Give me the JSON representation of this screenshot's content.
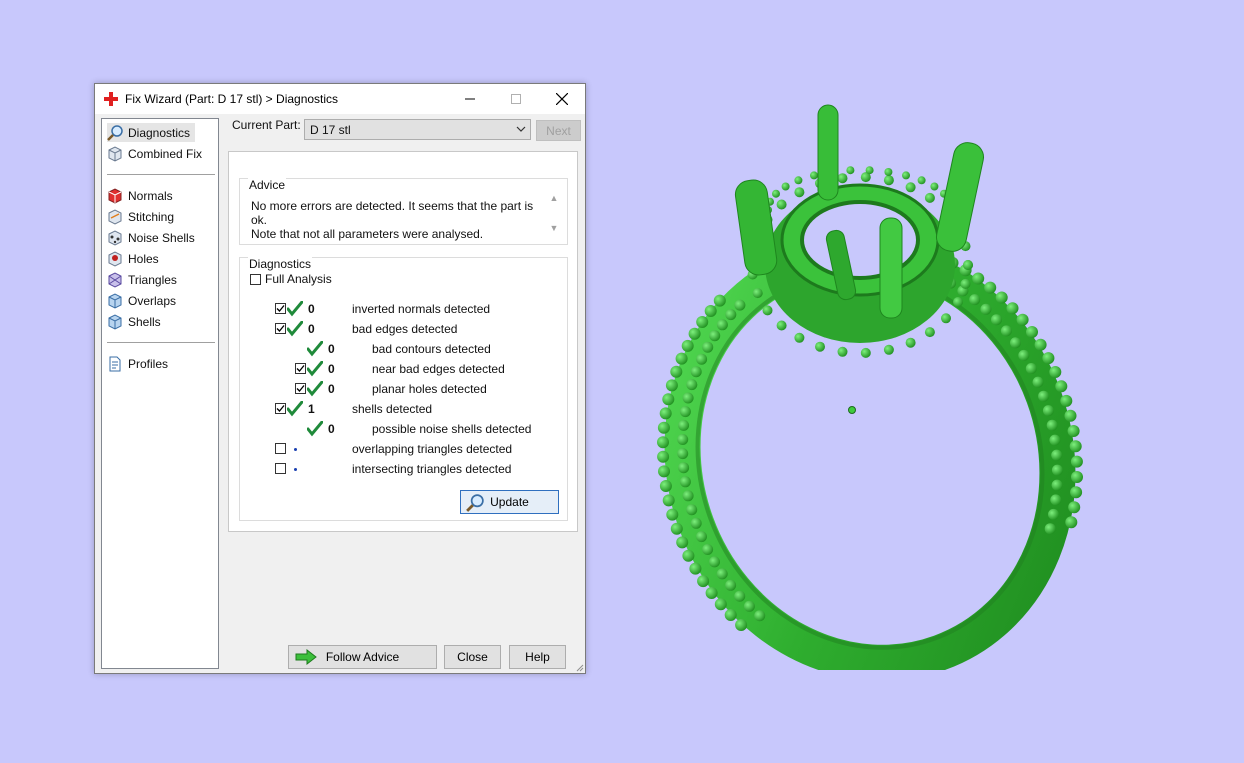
{
  "window": {
    "title": "Fix Wizard (Part: D 17 stl) > Diagnostics"
  },
  "sidebar": {
    "items": [
      {
        "label": "Diagnostics",
        "icon": "magnifier-icon"
      },
      {
        "label": "Combined Fix",
        "icon": "cube-icon"
      },
      {
        "label": "Normals",
        "icon": "normals-icon"
      },
      {
        "label": "Stitching",
        "icon": "stitching-icon"
      },
      {
        "label": "Noise Shells",
        "icon": "noise-shells-icon"
      },
      {
        "label": "Holes",
        "icon": "holes-icon"
      },
      {
        "label": "Triangles",
        "icon": "triangles-icon"
      },
      {
        "label": "Overlaps",
        "icon": "overlaps-icon"
      },
      {
        "label": "Shells",
        "icon": "shells-icon"
      },
      {
        "label": "Profiles",
        "icon": "document-icon"
      }
    ]
  },
  "header": {
    "current_part_label": "Current Part:",
    "current_part_value": "D 17 stl",
    "next_label": "Next"
  },
  "advice": {
    "title": "Advice",
    "line1": "No more errors are detected. It seems that the part is ok.",
    "line2": "Note that not all parameters were analysed."
  },
  "diagnostics": {
    "title": "Diagnostics",
    "full_analysis_label": "Full Analysis",
    "rows": [
      {
        "checked": true,
        "status": "ok",
        "count": "0",
        "label": "inverted normals detected"
      },
      {
        "checked": true,
        "status": "ok",
        "count": "0",
        "label": "bad edges detected"
      },
      {
        "checked": null,
        "status": "ok",
        "count": "0",
        "label": "bad contours detected"
      },
      {
        "checked": true,
        "status": "ok",
        "count": "0",
        "label": "near bad edges detected"
      },
      {
        "checked": true,
        "status": "ok",
        "count": "0",
        "label": "planar holes detected"
      },
      {
        "checked": true,
        "status": "ok",
        "count": "1",
        "label": "shells detected"
      },
      {
        "checked": null,
        "status": "ok",
        "count": "0",
        "label": "possible noise shells detected"
      },
      {
        "checked": false,
        "status": "none",
        "count": "",
        "label": "overlapping triangles detected"
      },
      {
        "checked": false,
        "status": "none",
        "count": "",
        "label": "intersecting triangles detected"
      }
    ],
    "update_label": "Update"
  },
  "footer": {
    "follow_advice_label": "Follow Advice",
    "close_label": "Close",
    "help_label": "Help"
  },
  "colors": {
    "background": "#c8c8fc",
    "model": "#3ecb3e",
    "check": "#1f8a3a"
  }
}
